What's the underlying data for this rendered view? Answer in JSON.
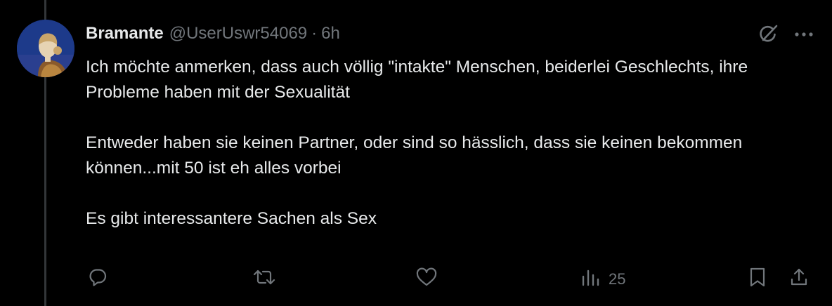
{
  "tweet": {
    "author_name": "Bramante",
    "author_handle": "@UserUswr54069",
    "separator": "·",
    "time": "6h",
    "paragraphs": [
      "Ich möchte anmerken, dass auch völlig \"intakte\" Menschen, beiderlei Geschlechts, ihre Probleme haben mit der Sexualität",
      "Entweder haben sie keinen Partner, oder sind so hässlich, dass sie keinen bekommen können...mit 50 ist eh alles vorbei",
      "Es gibt interessantere Sachen als Sex"
    ]
  },
  "actions": {
    "views_count": "25"
  },
  "icons": {
    "grok": "grok-icon",
    "more": "more-icon",
    "reply": "reply-icon",
    "retweet": "retweet-icon",
    "like": "like-icon",
    "views": "views-icon",
    "bookmark": "bookmark-icon",
    "share": "share-icon"
  },
  "colors": {
    "background": "#000000",
    "text_primary": "#e7e9ea",
    "text_secondary": "#71767b",
    "thread_line": "#333639"
  }
}
